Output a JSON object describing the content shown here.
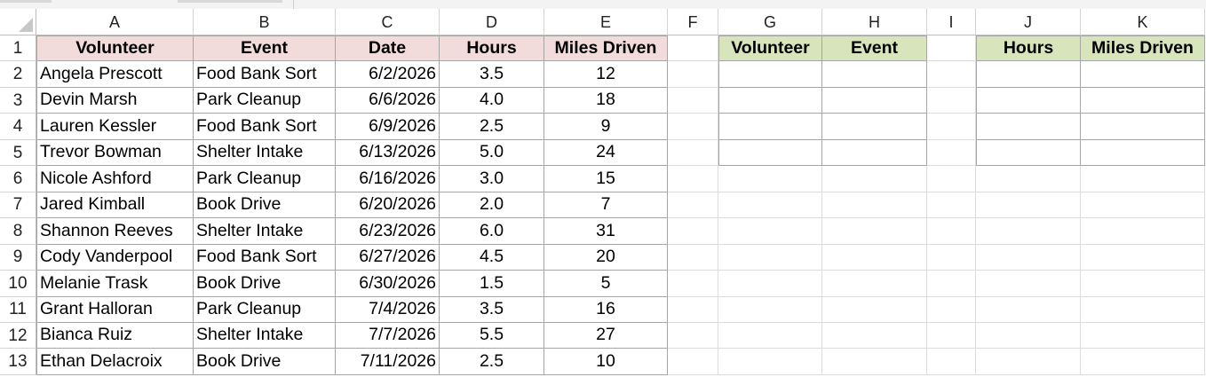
{
  "columns": [
    "A",
    "B",
    "C",
    "D",
    "E",
    "F",
    "G",
    "H",
    "I",
    "J",
    "K"
  ],
  "source_headers": [
    "Volunteer",
    "Event",
    "Date",
    "Hours",
    "Miles Driven"
  ],
  "rows": [
    [
      "Angela Prescott",
      "Food Bank Sort",
      "6/2/2026",
      "3.5",
      "12"
    ],
    [
      "Devin Marsh",
      "Park Cleanup",
      "6/6/2026",
      "4.0",
      "18"
    ],
    [
      "Lauren Kessler",
      "Food Bank Sort",
      "6/9/2026",
      "2.5",
      "9"
    ],
    [
      "Trevor Bowman",
      "Shelter Intake",
      "6/13/2026",
      "5.0",
      "24"
    ],
    [
      "Nicole Ashford",
      "Park Cleanup",
      "6/16/2026",
      "3.0",
      "15"
    ],
    [
      "Jared Kimball",
      "Book Drive",
      "6/20/2026",
      "2.0",
      "7"
    ],
    [
      "Shannon Reeves",
      "Shelter Intake",
      "6/23/2026",
      "6.0",
      "31"
    ],
    [
      "Cody Vanderpool",
      "Food Bank Sort",
      "6/27/2026",
      "4.5",
      "20"
    ],
    [
      "Melanie Trask",
      "Book Drive",
      "6/30/2026",
      "1.5",
      "5"
    ],
    [
      "Grant Halloran",
      "Park Cleanup",
      "7/4/2026",
      "3.5",
      "16"
    ],
    [
      "Bianca Ruiz",
      "Shelter Intake",
      "7/7/2026",
      "5.5",
      "27"
    ],
    [
      "Ethan Delacroix",
      "Book Drive",
      "7/11/2026",
      "2.5",
      "10"
    ]
  ],
  "table2_headers": [
    "Volunteer",
    "Event"
  ],
  "table3_headers": [
    "Hours",
    "Miles Driven"
  ],
  "colors": {
    "source_header_fill": "#f2dcdb",
    "output_header_fill": "#d8e4bc",
    "border": "#a6a6a6"
  }
}
